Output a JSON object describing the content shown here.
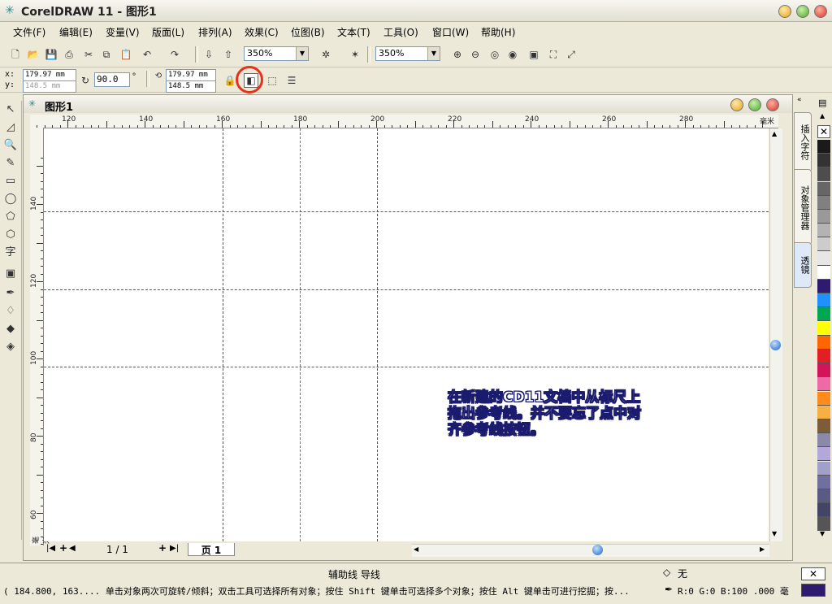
{
  "window": {
    "title": "CorelDRAW 11 - 图形1"
  },
  "menu": [
    "文件(F)",
    "编辑(E)",
    "变量(V)",
    "版面(L)",
    "排列(A)",
    "效果(C)",
    "位图(B)",
    "文本(T)",
    "工具(O)",
    "窗口(W)",
    "帮助(H)"
  ],
  "toolbar": {
    "zoom_left": "350%",
    "zoom_right": "350%"
  },
  "propbar": {
    "x_label": "x:",
    "y_label": "y:",
    "x_value": "179.97 mm",
    "y_value": "148.5 mm",
    "rotation": "90.0",
    "degree": "°",
    "guide_x": "179.97 mm",
    "guide_y": "148.5 mm"
  },
  "document": {
    "title": "图形1"
  },
  "ruler": {
    "h_labels": [
      "120",
      "140",
      "160",
      "180",
      "200",
      "220",
      "240",
      "260",
      "280"
    ],
    "h_unit": "毫米",
    "v_labels": [
      "140",
      "120",
      "100",
      "80",
      "60"
    ],
    "v_unit": "毫米"
  },
  "pagenav": {
    "current": "1 / 1",
    "tab": "页 1"
  },
  "annotation": {
    "line1": "在新建的CD11文档中从标尺上",
    "line2": "拖出参考线。并不要忘了点中对",
    "line3": "齐参考线按钮。"
  },
  "docker": {
    "tab1": "插入字符",
    "tab2": "对象管理器",
    "tab3": "透镜"
  },
  "palette": [
    "#1a1a1a",
    "#333333",
    "#4d4d4d",
    "#666666",
    "#808080",
    "#999999",
    "#b3b3b3",
    "#cccccc",
    "#e6e6e6",
    "#ffffff",
    "#2e1a6e",
    "#1e90ff",
    "#00a651",
    "#ffff00",
    "#ff6600",
    "#e31e24",
    "#d4145a",
    "#ee6aa7",
    "#ff8c1a",
    "#f5b041",
    "#7d5c3a",
    "#8a8aa8",
    "#b3a8d9",
    "#a0a0c8",
    "#7070a0",
    "#5a5a82",
    "#444466",
    "#555555"
  ],
  "status": {
    "guide_info": "辅助线 导线",
    "fill_label": "无",
    "hint": "( 184.800, 163.... 单击对象两次可旋转/倾斜；双击工具可选择所有对象；按住 Shift 键单击可选择多个对象；按住 Alt 键单击可进行挖掘；按...",
    "color_info": "R:0 G:0 B:100 .000 毫",
    "outline_color": "#2e1a6e"
  }
}
